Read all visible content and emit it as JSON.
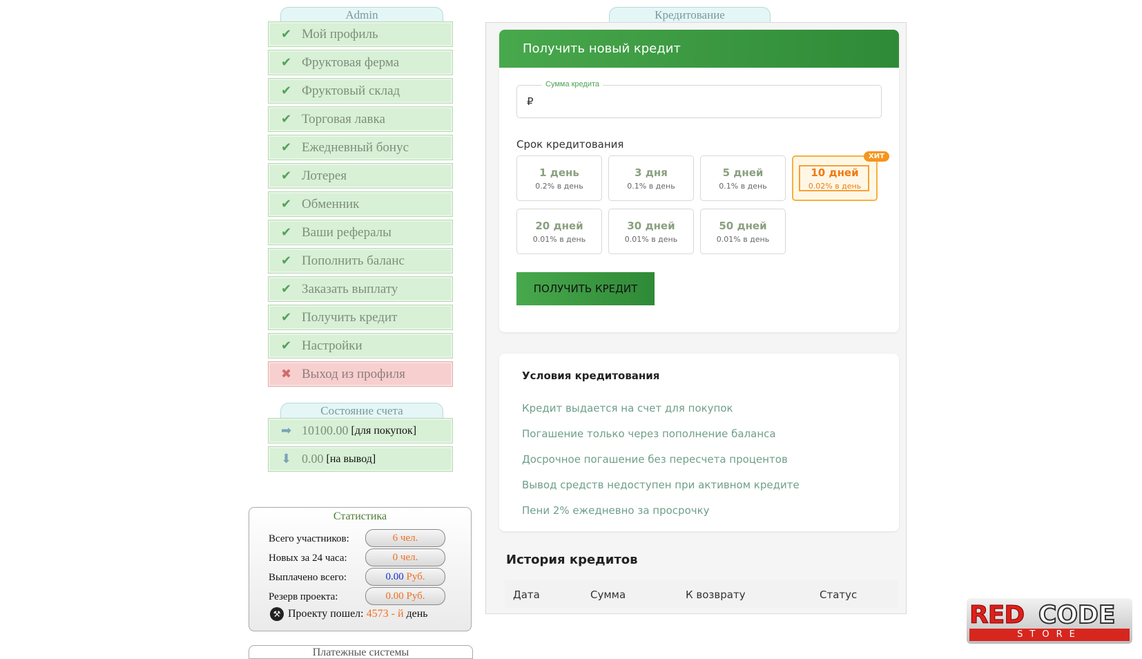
{
  "left": {
    "admin_tab": "Admin",
    "menu": [
      {
        "label": "Мой профиль",
        "icon": "check-icon"
      },
      {
        "label": "Фруктовая ферма",
        "icon": "check-icon"
      },
      {
        "label": "Фруктовый склад",
        "icon": "check-icon"
      },
      {
        "label": "Торговая лавка",
        "icon": "check-icon"
      },
      {
        "label": "Ежедневный бонус",
        "icon": "check-icon"
      },
      {
        "label": "Лотерея",
        "icon": "check-icon"
      },
      {
        "label": "Обменник",
        "icon": "check-icon"
      },
      {
        "label": "Ваши рефералы",
        "icon": "check-icon"
      },
      {
        "label": "Пополнить баланс",
        "icon": "check-icon"
      },
      {
        "label": "Заказать выплату",
        "icon": "check-icon"
      },
      {
        "label": "Получить кредит",
        "icon": "check-icon"
      },
      {
        "label": "Настройки",
        "icon": "check-icon"
      },
      {
        "label": "Выход из профиля",
        "icon": "cross-icon"
      }
    ],
    "account_tab": "Состояние счета",
    "account": [
      {
        "value": "10100.00",
        "note": "[для покупок]",
        "icon": "arrow-right-icon"
      },
      {
        "value": "0.00",
        "note": "[на вывод]",
        "icon": "arrow-down-icon"
      }
    ],
    "stats": {
      "title": "Статистика",
      "rows": [
        {
          "label": "Всего участников:",
          "value": "6 чел."
        },
        {
          "label": "Новых за 24 часа:",
          "value": "0 чел."
        },
        {
          "label": "Выплачено всего:",
          "value_num": "0.00",
          "value_unit": "Руб."
        },
        {
          "label": "Резерв проекта:",
          "value": "0.00 Руб."
        }
      ],
      "launch_prefix": "Проекту пошел:",
      "launch_days": "4573 - й",
      "launch_suffix": "день"
    },
    "payments_tab": "Платежные системы"
  },
  "main": {
    "tab": "Кредитование",
    "card_title": "Получить новый кредит",
    "amount_label": "Сумма кредита",
    "amount_value": "₽",
    "term_label": "Срок кредитования",
    "terms": [
      {
        "days": "1 день",
        "rate": "0.2% в день"
      },
      {
        "days": "3 дня",
        "rate": "0.1% в день"
      },
      {
        "days": "5 дней",
        "rate": "0.1% в день"
      },
      {
        "days": "10 дней",
        "rate": "0.02% в день",
        "badge": "ХИТ"
      },
      {
        "days": "20 дней",
        "rate": "0.01% в день"
      },
      {
        "days": "30 дней",
        "rate": "0.01% в день"
      },
      {
        "days": "50 дней",
        "rate": "0.01% в день"
      }
    ],
    "submit_label": "ПОЛУЧИТЬ КРЕДИТ",
    "conditions": {
      "title": "Условия кредитования",
      "items": [
        "Кредит выдается на счет для покупок",
        "Погашение только через пополнение баланса",
        "Досрочное погашение без пересчета процентов",
        "Вывод средств недоступен при активном кредите",
        "Пени 2% ежедневно за просрочку"
      ]
    },
    "history": {
      "title": "История кредитов",
      "columns": [
        "Дата",
        "Сумма",
        "К возврату",
        "Статус"
      ]
    }
  },
  "logo": {
    "red": "RED",
    "code": "CODE",
    "store": "STORE"
  }
}
